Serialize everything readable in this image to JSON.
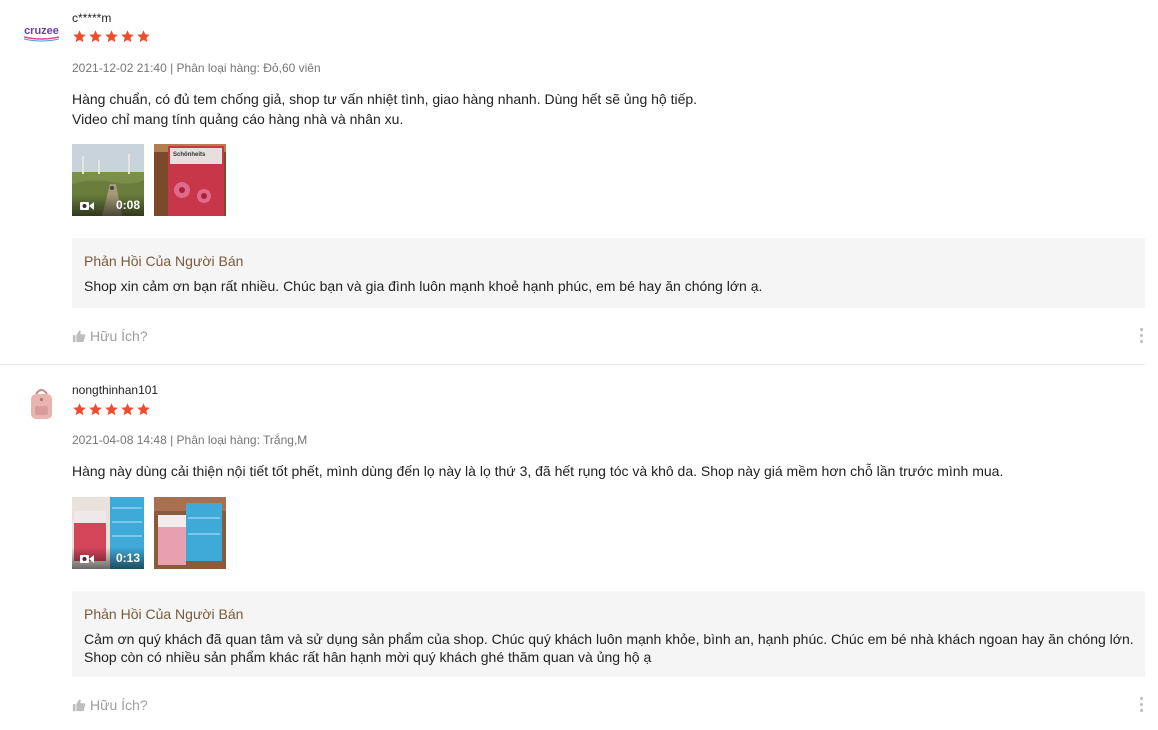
{
  "reviews": [
    {
      "username": "c*****m",
      "avatar_logo_text": "cruzee",
      "rating": 5,
      "meta": "2021-12-02 21:40 | Phân loại hàng: Đỏ,60 viên",
      "content_lines": [
        "Hàng chuẩn, có đủ tem chống giả, shop tư vấn nhiệt tình, giao hàng nhanh. Dùng hết sẽ ủng hộ tiếp.",
        "Video chỉ mang tính quảng cáo hàng nhà và nhân xu."
      ],
      "video_duration": "0:08",
      "product_box_text": "Schönheits",
      "reply_title": "Phản Hồi Của Người Bán",
      "reply_text": "Shop xin cảm ơn bạn rất nhiều. Chúc bạn và gia đình luôn mạnh khoẻ hạnh phúc, em bé hay ăn chóng lớn ạ.",
      "helpful_label": "Hữu Ích?"
    },
    {
      "username": "nongthinhan101",
      "rating": 5,
      "meta": "2021-04-08 14:48 | Phân loại hàng: Trắng,M",
      "content_lines": [
        "Hàng này dùng cải thiện nội tiết tốt phết, mình dùng đến lọ này là lọ thứ 3, đã hết rụng tóc và khô da. Shop này giá mềm hơn chỗ lần trước mình mua."
      ],
      "video_duration": "0:13",
      "reply_title": "Phản Hồi Của Người Bán",
      "reply_text": "Cảm ơn quý khách đã quan tâm và sử dụng sản phẩm của shop. Chúc quý khách luôn mạnh khỏe, bình an, hạnh phúc. Chúc em bé nhà khách ngoan hay ăn chóng lớn.\nShop còn có  nhiều sản phẩm khác rất hân hạnh mời quý khách ghé thăm quan và ủng hộ ạ",
      "helpful_label": "Hữu Ích?"
    }
  ],
  "colors": {
    "star": "#ee4d2d",
    "reply_bg": "#f5f5f5",
    "reply_title": "#7a5a3a",
    "muted": "#757575"
  }
}
